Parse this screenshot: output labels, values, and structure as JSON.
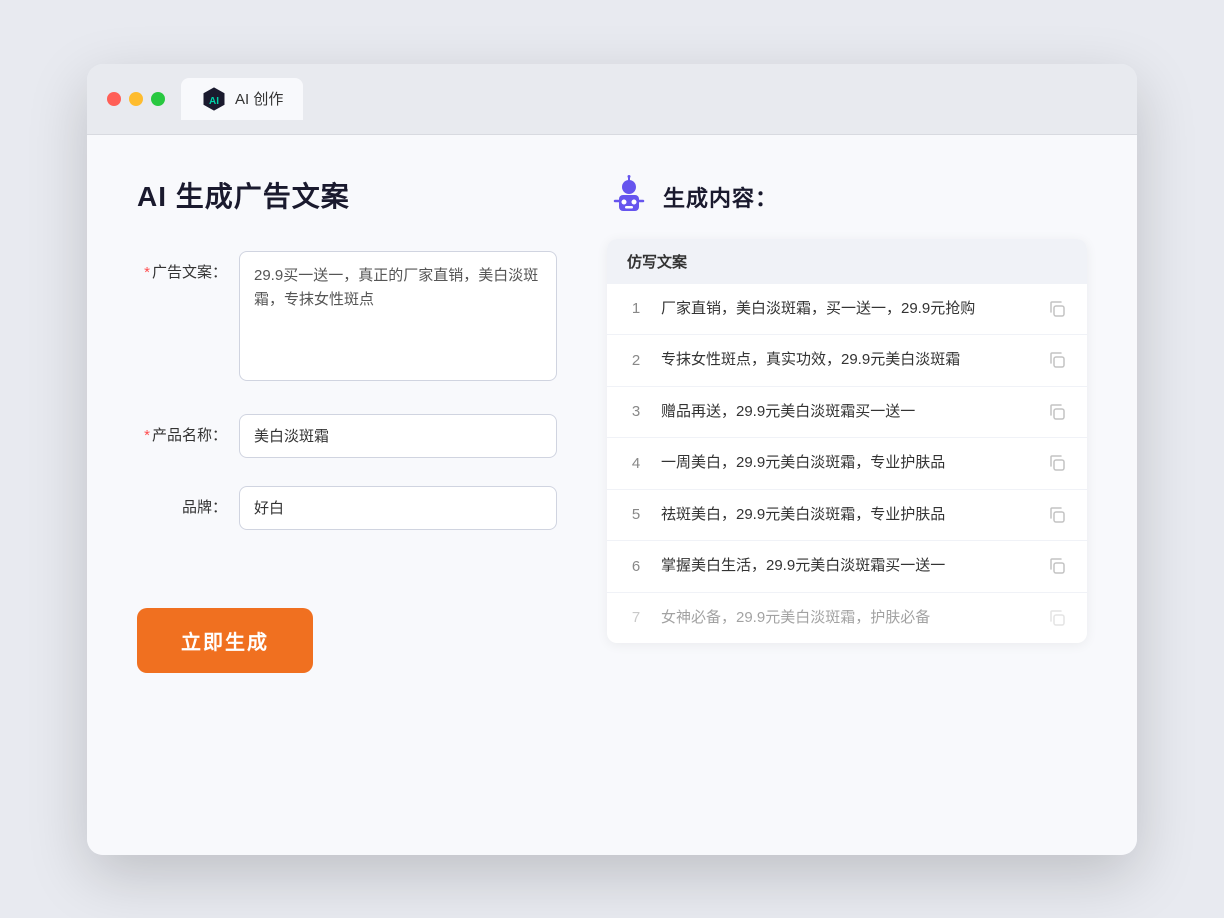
{
  "browser": {
    "tab_label": "AI 创作"
  },
  "page": {
    "title": "AI 生成广告文案",
    "form": {
      "ad_copy_label": "广告文案：",
      "ad_copy_required": "＊",
      "ad_copy_value": "29.9买一送一，真正的厂家直销，美白淡斑霜，专抹女性斑点",
      "product_name_label": "产品名称：",
      "product_name_required": "＊",
      "product_name_value": "美白淡斑霜",
      "brand_label": "品牌：",
      "brand_value": "好白",
      "generate_button": "立即生成"
    },
    "result": {
      "header_label": "生成内容：",
      "table_col": "仿写文案",
      "rows": [
        {
          "num": "1",
          "text": "厂家直销，美白淡斑霜，买一送一，29.9元抢购",
          "faded": false
        },
        {
          "num": "2",
          "text": "专抹女性斑点，真实功效，29.9元美白淡斑霜",
          "faded": false
        },
        {
          "num": "3",
          "text": "赠品再送，29.9元美白淡斑霜买一送一",
          "faded": false
        },
        {
          "num": "4",
          "text": "一周美白，29.9元美白淡斑霜，专业护肤品",
          "faded": false
        },
        {
          "num": "5",
          "text": "祛斑美白，29.9元美白淡斑霜，专业护肤品",
          "faded": false
        },
        {
          "num": "6",
          "text": "掌握美白生活，29.9元美白淡斑霜买一送一",
          "faded": false
        },
        {
          "num": "7",
          "text": "女神必备，29.9元美白淡斑霜，护肤必备",
          "faded": true
        }
      ]
    }
  }
}
